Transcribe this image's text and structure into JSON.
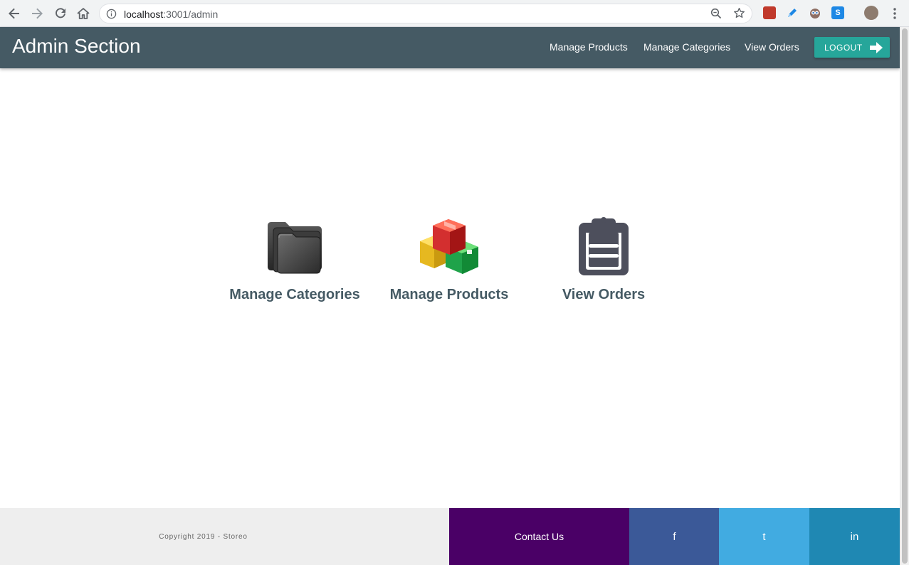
{
  "browser": {
    "url_host": "localhost",
    "url_rest": ":3001/admin"
  },
  "header": {
    "brand": "Admin Section",
    "nav": [
      {
        "label": "Manage Products"
      },
      {
        "label": "Manage Categories"
      },
      {
        "label": "View Orders"
      }
    ],
    "logout_label": "LOGOUT"
  },
  "tiles": [
    {
      "label": "Manage Categories",
      "icon": "folder-icon"
    },
    {
      "label": "Manage Products",
      "icon": "boxes-icon"
    },
    {
      "label": "View Orders",
      "icon": "clipboard-icon"
    }
  ],
  "footer": {
    "copyright": "Copyright 2019 - Storeo",
    "contact": "Contact Us",
    "social": [
      {
        "label": "f",
        "color": "#3b5998"
      },
      {
        "label": "t",
        "color": "#41abe1"
      },
      {
        "label": "in",
        "color": "#1f88b3"
      }
    ]
  },
  "colors": {
    "header_bg": "#455a64",
    "accent": "#26a69a",
    "contact_bg": "#4a0066"
  }
}
